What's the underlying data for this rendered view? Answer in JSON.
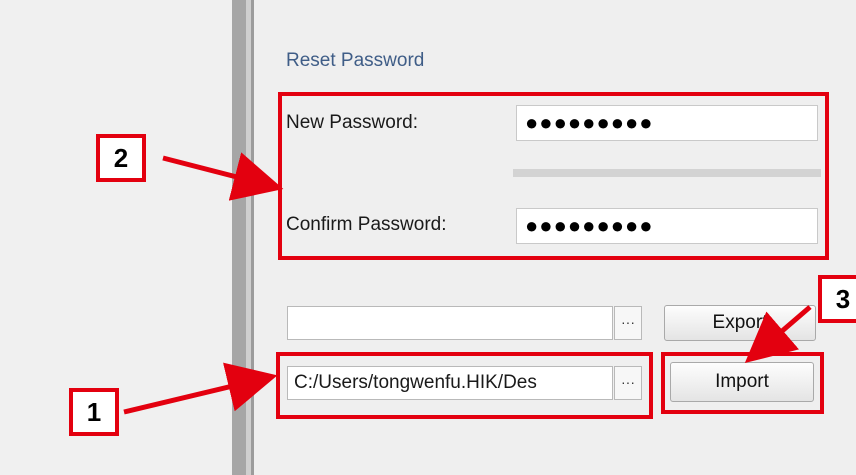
{
  "section": {
    "title": "Reset Password"
  },
  "form": {
    "new_password_label": "New Password:",
    "new_password_value": "●●●●●●●●●",
    "confirm_password_label": "Confirm Password:",
    "confirm_password_value": "●●●●●●●●●"
  },
  "export_row": {
    "path_value": "",
    "browse_label": "···",
    "button_label": "Export"
  },
  "import_row": {
    "path_value": "C:/Users/tongwenfu.HIK/Des",
    "browse_label": "···",
    "button_label": "Import"
  },
  "callouts": {
    "one": "1",
    "two": "2",
    "three": "3"
  },
  "colors": {
    "annotation": "#e3000f",
    "title": "#3f5d87"
  }
}
